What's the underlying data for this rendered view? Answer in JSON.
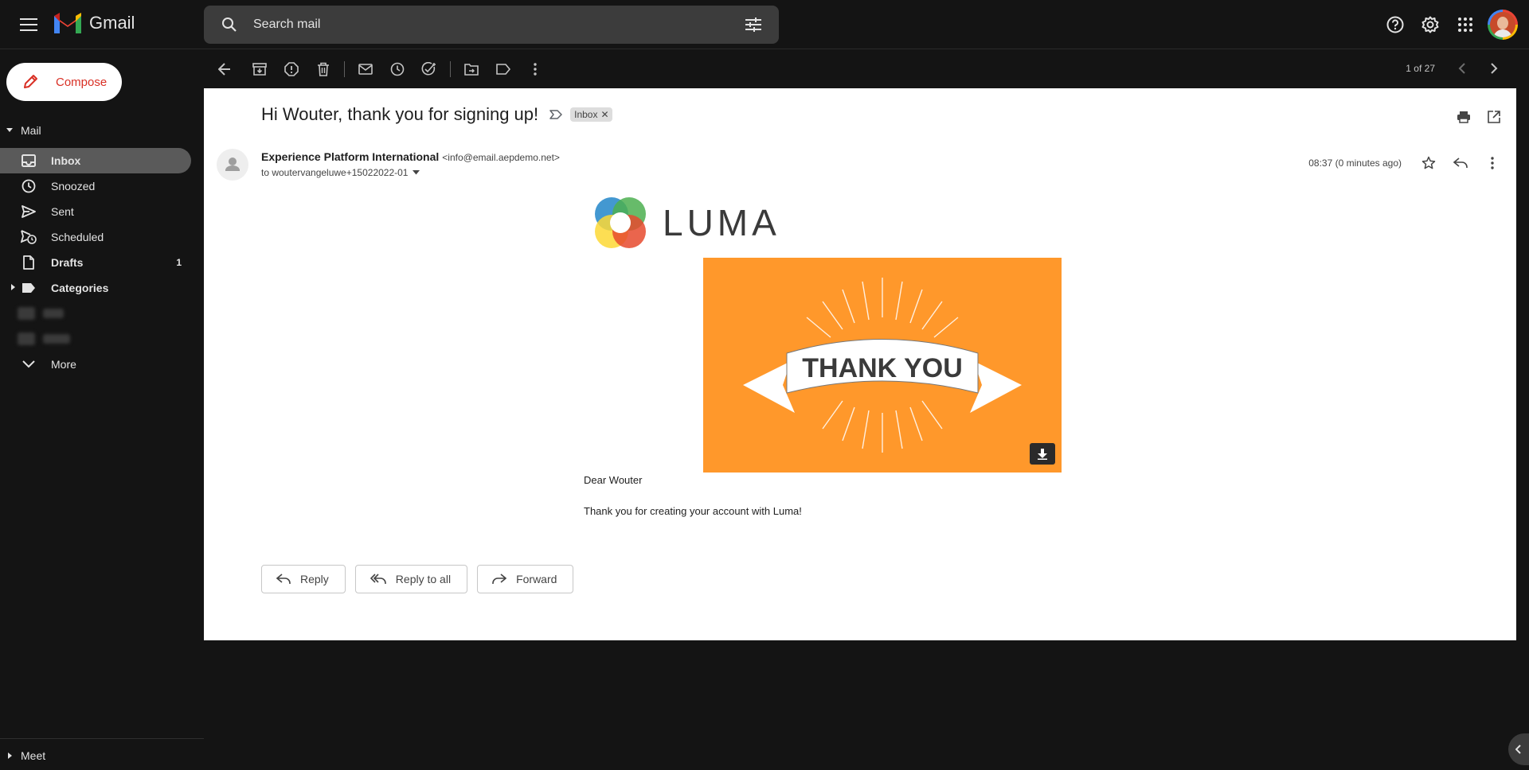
{
  "app": {
    "name": "Gmail"
  },
  "search": {
    "placeholder": "Search mail"
  },
  "sidebar": {
    "compose_label": "Compose",
    "section_label": "Mail",
    "items": [
      {
        "label": "Inbox",
        "count": ""
      },
      {
        "label": "Snoozed",
        "count": ""
      },
      {
        "label": "Sent",
        "count": ""
      },
      {
        "label": "Scheduled",
        "count": ""
      },
      {
        "label": "Drafts",
        "count": "1"
      },
      {
        "label": "Categories",
        "count": ""
      }
    ],
    "more_label": "More",
    "meet_label": "Meet"
  },
  "toolbar": {
    "pager": "1 of 27"
  },
  "email": {
    "subject": "Hi Wouter, thank you for signing up!",
    "label_chip": "Inbox",
    "sender_name": "Experience Platform International",
    "sender_email": "<info@email.aepdemo.net>",
    "to": "to woutervangeluwe+15022022-01",
    "time": "08:37 (0 minutes ago)",
    "brand": "LUMA",
    "hero_text": "THANK YOU",
    "greeting": "Dear Wouter",
    "message": "Thank you for creating your account with Luma!"
  },
  "actions": {
    "reply": "Reply",
    "reply_all": "Reply to all",
    "forward": "Forward"
  },
  "colors": {
    "accent": "#d93025",
    "hero": "#ff982b",
    "background": "#141414"
  }
}
